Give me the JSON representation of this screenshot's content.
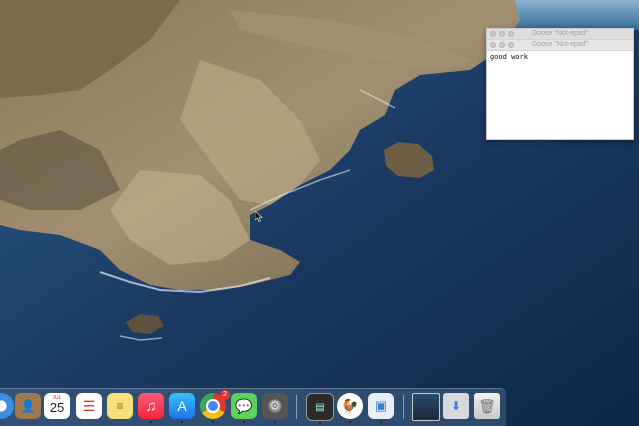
{
  "notepad_windows": [
    {
      "title": "Goose \"Not-epad\""
    },
    {
      "title": "Goose \"Not-epad\""
    }
  ],
  "notepad": {
    "content": "good work"
  },
  "dock": {
    "items": [
      {
        "name": "safari",
        "running": false
      },
      {
        "name": "contacts",
        "running": false
      },
      {
        "name": "calendar",
        "running": false,
        "month": "JUL",
        "day": "25"
      },
      {
        "name": "reminders",
        "running": false
      },
      {
        "name": "notes",
        "running": false
      },
      {
        "name": "music",
        "running": true
      },
      {
        "name": "app-store",
        "running": true
      },
      {
        "name": "chrome",
        "running": true,
        "badge": "2"
      },
      {
        "name": "wechat",
        "running": true
      },
      {
        "name": "system-preferences",
        "running": true
      },
      {
        "name": "activity-monitor",
        "running": true
      },
      {
        "name": "goose",
        "running": true
      },
      {
        "name": "preview",
        "running": true
      },
      {
        "name": "photo-folder",
        "running": false
      },
      {
        "name": "downloads",
        "running": false
      },
      {
        "name": "trash",
        "running": false
      }
    ]
  },
  "colors": {
    "ocean": "#1b3a62",
    "rock": "#9c8866",
    "dock": "#466487"
  }
}
